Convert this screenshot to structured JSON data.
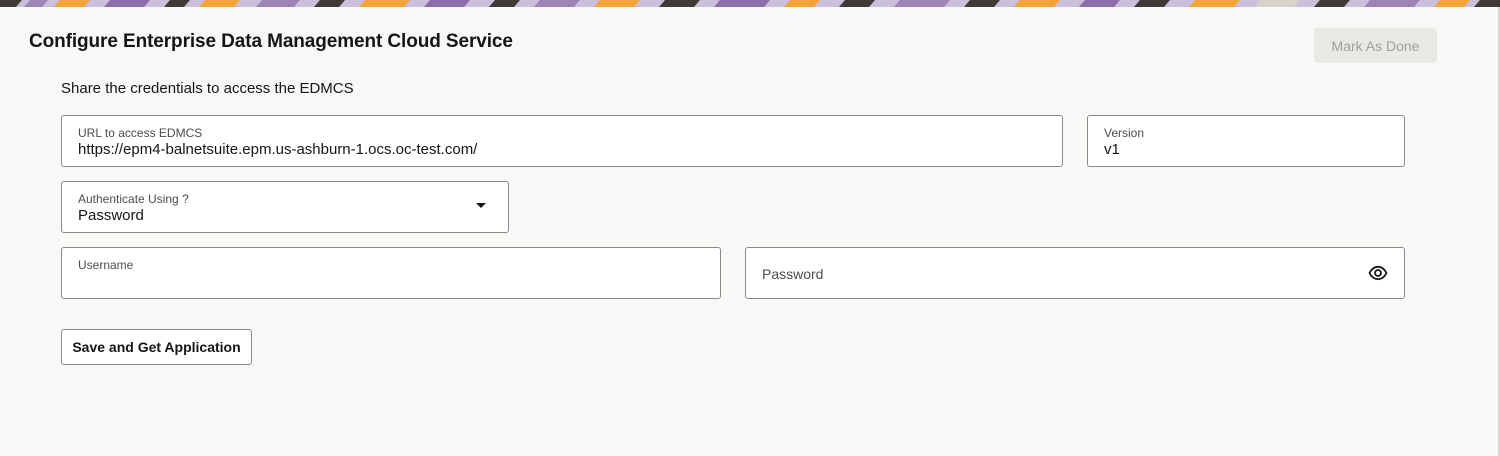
{
  "page": {
    "title": "Configure Enterprise Data Management Cloud Service",
    "mark_done_label": "Mark As Done",
    "instruction": "Share the credentials to access the EDMCS"
  },
  "form": {
    "url": {
      "label": "URL to access EDMCS",
      "value": "https://epm4-balnetsuite.epm.us-ashburn-1.ocs.oc-test.com/"
    },
    "version": {
      "label": "Version",
      "value": "v1"
    },
    "auth": {
      "label": "Authenticate Using ?",
      "value": "Password",
      "icon": "chevron-down-icon"
    },
    "username": {
      "label": "Username",
      "value": ""
    },
    "password": {
      "label": "Password",
      "value": "",
      "icon": "eye-icon"
    },
    "save_label": "Save and Get Application"
  },
  "colors": {
    "background": "#f9f8f6",
    "field_border": "#8d8a86",
    "disabled_button_bg": "#eae8e5",
    "disabled_button_text": "#a19f9c",
    "banner_purple": "#9c85b5",
    "banner_orange": "#f3a53a"
  }
}
